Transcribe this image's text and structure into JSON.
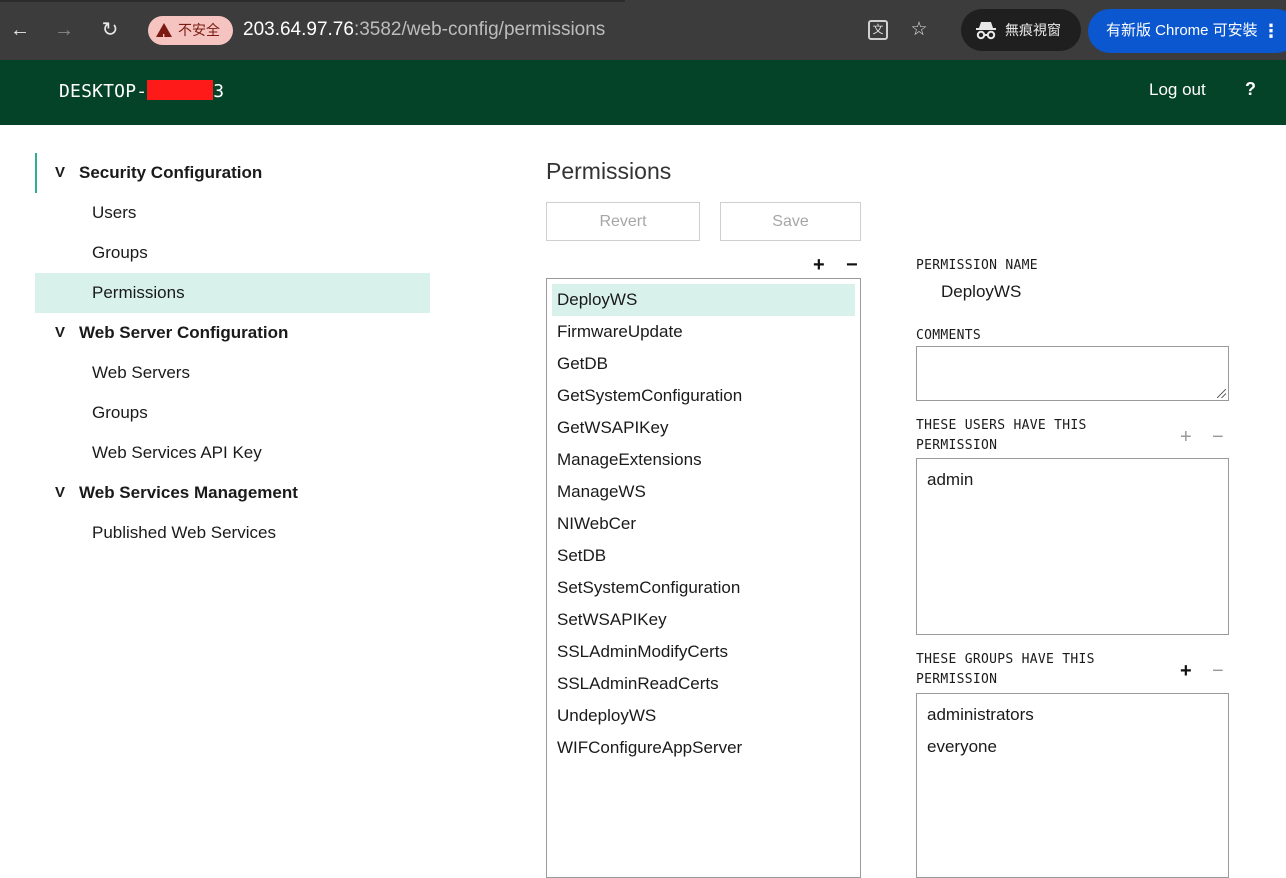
{
  "browser": {
    "insecure_label": "不安全",
    "url_host": "203.64.97.76",
    "url_rest": ":3582/web-config/permissions",
    "incognito_label": "無痕視窗",
    "update_label": "有新版 Chrome 可安裝"
  },
  "header": {
    "hostname_prefix": "DESKTOP-",
    "hostname_suffix": "3",
    "logout_label": "Log out",
    "help_label": "?"
  },
  "sidebar": {
    "sections": [
      {
        "title": "Security Configuration",
        "items": [
          "Users",
          "Groups",
          "Permissions"
        ]
      },
      {
        "title": "Web Server Configuration",
        "items": [
          "Web Servers",
          "Groups",
          "Web Services API Key"
        ]
      },
      {
        "title": "Web Services Management",
        "items": [
          "Published Web Services"
        ]
      }
    ],
    "active_item": "Permissions"
  },
  "main": {
    "title": "Permissions",
    "revert_label": "Revert",
    "save_label": "Save",
    "permissions": [
      "DeployWS",
      "FirmwareUpdate",
      "GetDB",
      "GetSystemConfiguration",
      "GetWSAPIKey",
      "ManageExtensions",
      "ManageWS",
      "NIWebCer",
      "SetDB",
      "SetSystemConfiguration",
      "SetWSAPIKey",
      "SSLAdminModifyCerts",
      "SSLAdminReadCerts",
      "UndeployWS",
      "WIFConfigureAppServer"
    ],
    "selected_permission": "DeployWS"
  },
  "detail": {
    "permission_name_label": "PERMISSION NAME",
    "permission_name_value": "DeployWS",
    "comments_label": "COMMENTS",
    "comments_value": "",
    "users_label_line1": "THESE USERS HAVE THIS",
    "users_label_line2": "PERMISSION",
    "users": [
      "admin"
    ],
    "groups_label_line1": "THESE GROUPS HAVE THIS",
    "groups_label_line2": "PERMISSION",
    "groups": [
      "administrators",
      "everyone"
    ]
  },
  "colors": {
    "header_bg": "#044328",
    "accent": "#2fae8e",
    "selected_bg": "#d8f2eb"
  }
}
